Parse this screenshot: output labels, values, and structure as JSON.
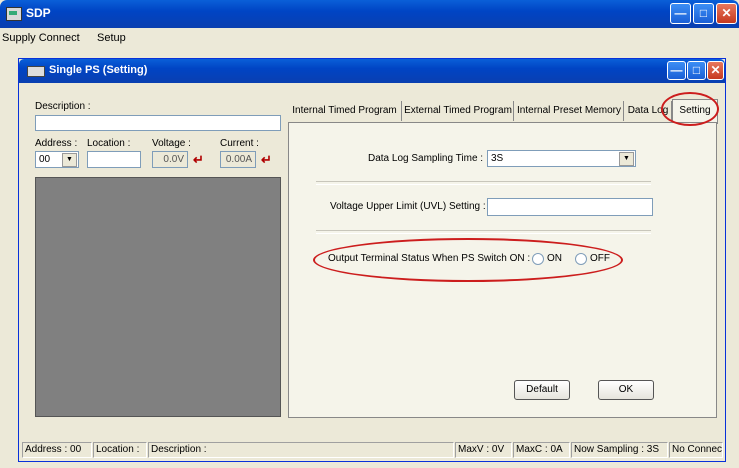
{
  "window": {
    "title": "SDP",
    "icon": "app-icon"
  },
  "menu": {
    "supply_connect": "Supply Connect",
    "setup": "Setup"
  },
  "child": {
    "title": "Single PS (Setting)"
  },
  "left": {
    "description_label": "Description :",
    "description_value": "",
    "address_label": "Address :",
    "address_value": "00",
    "location_label": "Location :",
    "location_value": "",
    "voltage_label": "Voltage :",
    "voltage_value": "0.0V",
    "current_label": "Current :",
    "current_value": "0.00A"
  },
  "tabs": [
    {
      "label": "Internal Timed Program"
    },
    {
      "label": "External Timed Program"
    },
    {
      "label": "Internal Preset Memory"
    },
    {
      "label": "Data Log"
    },
    {
      "label": "Setting"
    }
  ],
  "setting": {
    "sampling_label": "Data Log Sampling Time :",
    "sampling_value": "3S",
    "uvl_label": "Voltage Upper Limit (UVL) Setting :",
    "uvl_value": "",
    "output_label": "Output Terminal Status When PS Switch ON :",
    "on_label": "ON",
    "off_label": "OFF",
    "default_button": "Default",
    "ok_button": "OK"
  },
  "status": {
    "address": "Address : 00",
    "location": "Location :",
    "description": "Description :",
    "maxv": "MaxV : 0V",
    "maxc": "MaxC : 0A",
    "sampling": "Now Sampling : 3S",
    "connection": "No Connection"
  },
  "colors": {
    "titlebar": "#0a5fd8",
    "annotation": "#cc1d1d",
    "panel": "#808080",
    "enter_arrow": "#b00000"
  }
}
